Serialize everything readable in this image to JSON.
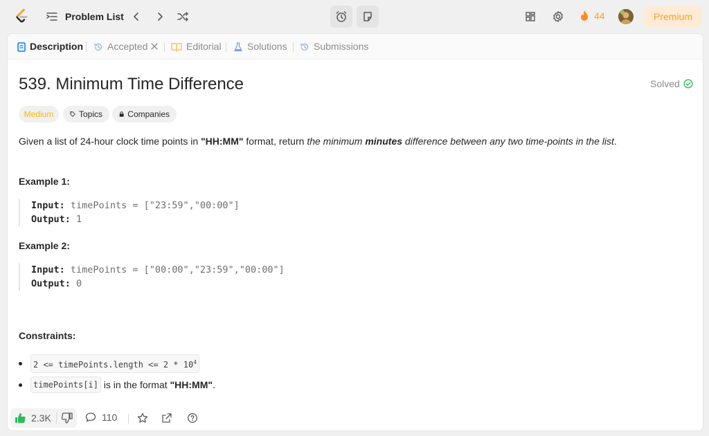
{
  "topbar": {
    "problem_list_label": "Problem List",
    "streak_count": "44",
    "premium_label": "Premium"
  },
  "tabs": [
    {
      "label": "Description"
    },
    {
      "label": "Accepted"
    },
    {
      "label": "Editorial"
    },
    {
      "label": "Solutions"
    },
    {
      "label": "Submissions"
    }
  ],
  "problem": {
    "title": "539. Minimum Time Difference",
    "status": "Solved",
    "difficulty": "Medium",
    "chips": {
      "topics": "Topics",
      "companies": "Companies"
    },
    "description": {
      "p1": "Given a list of 24-hour clock time points in ",
      "b1": "\"HH:MM\"",
      "p2": " format, return ",
      "i1": "the minimum ",
      "bi": "minutes",
      "i2": " difference between any two time-points in the list",
      "end": "."
    },
    "examples": [
      {
        "title": "Example 1:",
        "input_label": "Input:",
        "input": "timePoints = [\"23:59\",\"00:00\"]",
        "output_label": "Output:",
        "output": "1"
      },
      {
        "title": "Example 2:",
        "input_label": "Input:",
        "input": "timePoints = [\"00:00\",\"23:59\",\"00:00\"]",
        "output_label": "Output:",
        "output": "0"
      }
    ],
    "constraints_title": "Constraints:",
    "constraints": {
      "c1_code": "2 <= timePoints.length <= 2 * 10",
      "c1_sup": "4",
      "c2_code": "timePoints[i]",
      "c2_text": " is in the format ",
      "c2_bold": "\"HH:MM\"",
      "c2_end": "."
    }
  },
  "footer": {
    "likes": "2.3K",
    "comments": "110"
  },
  "colors": {
    "accent": "#ffa116",
    "medium": "#ffb800",
    "solved": "#2cbb5d",
    "like_green": "#2cbb5d"
  }
}
